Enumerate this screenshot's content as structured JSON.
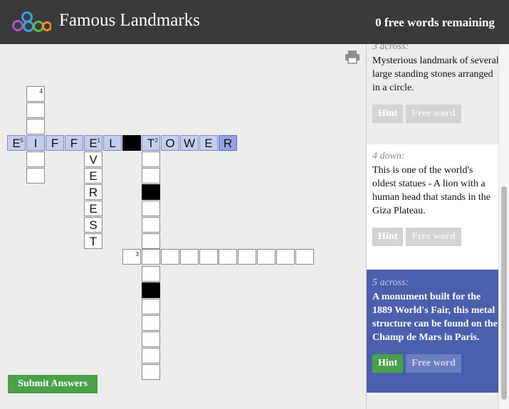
{
  "header": {
    "title": "Famous Landmarks",
    "free_words_remaining": "0 free words remaining"
  },
  "puzzle": {
    "numbers": {
      "n1": "1",
      "n2": "2",
      "n3": "3",
      "n4": "4",
      "n5": "5"
    },
    "letters": {
      "r_e": "E",
      "r_i": "I",
      "r_f1": "F",
      "r_f2": "F",
      "r_e2": "E",
      "r_l": "L",
      "r_t": "T",
      "r_o": "O",
      "r_w": "W",
      "r_e3": "E",
      "r_r": "R",
      "d_v": "V",
      "d_e": "E",
      "d_r": "R",
      "d_e2": "E",
      "d_s": "S",
      "d_t": "T"
    }
  },
  "submit_label": "Submit Answers",
  "clues": [
    {
      "label": "3 across:",
      "text": "Mysterious landmark of several large standing stones arranged in a circle.",
      "hint": "Hint",
      "free_word": "Free word"
    },
    {
      "label": "4 down:",
      "text": "This is one of the world's oldest statues - A lion with a human head that stands in the Giza Plateau.",
      "hint": "Hint",
      "free_word": "Free word"
    },
    {
      "label": "5 across:",
      "text": "A monument built for the 1889 World's Fair, this metal structure can be found on the Champ de Mars in Paris.",
      "hint": "Hint",
      "free_word": "Free word"
    }
  ]
}
